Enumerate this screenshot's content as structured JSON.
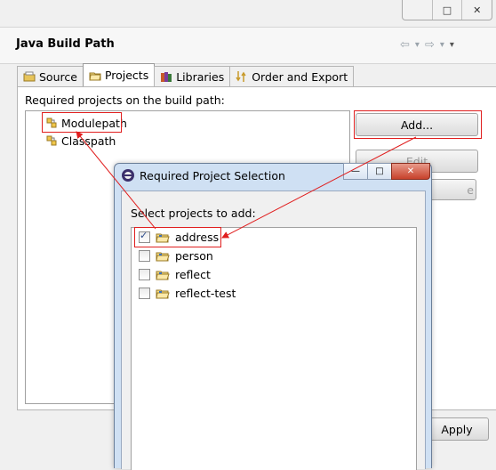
{
  "window_controls": {
    "restore": "□",
    "close": "✕"
  },
  "header": {
    "title": "Java Build Path",
    "nav": [
      "⇦",
      "▾",
      "⇨",
      "▾",
      "▾"
    ]
  },
  "tabs": [
    {
      "label": "Source",
      "icon": "source-folder-icon"
    },
    {
      "label": "Projects",
      "icon": "projects-icon",
      "active": true
    },
    {
      "label": "Libraries",
      "icon": "libraries-icon"
    },
    {
      "label": "Order and Export",
      "icon": "order-export-icon"
    }
  ],
  "projects_panel": {
    "label": "Required projects on the build path:",
    "tree": [
      {
        "label": "Modulepath",
        "icon": "modulepath-icon"
      },
      {
        "label": "Classpath",
        "icon": "classpath-icon"
      }
    ],
    "buttons": {
      "add": "Add...",
      "edit": "Edit",
      "remove": "e",
      "apply": "Apply"
    }
  },
  "dialog": {
    "title": "Required Project Selection",
    "prompt": "Select projects to add:",
    "controls": {
      "minimize": "—",
      "maximize": "□",
      "close": "✕"
    },
    "projects": [
      {
        "name": "address",
        "checked": true
      },
      {
        "name": "person",
        "checked": false
      },
      {
        "name": "reflect",
        "checked": false
      },
      {
        "name": "reflect-test",
        "checked": false
      }
    ]
  },
  "colors": {
    "annotation_red": "#e01e1e",
    "dialog_frame": "#cfe0f3"
  }
}
